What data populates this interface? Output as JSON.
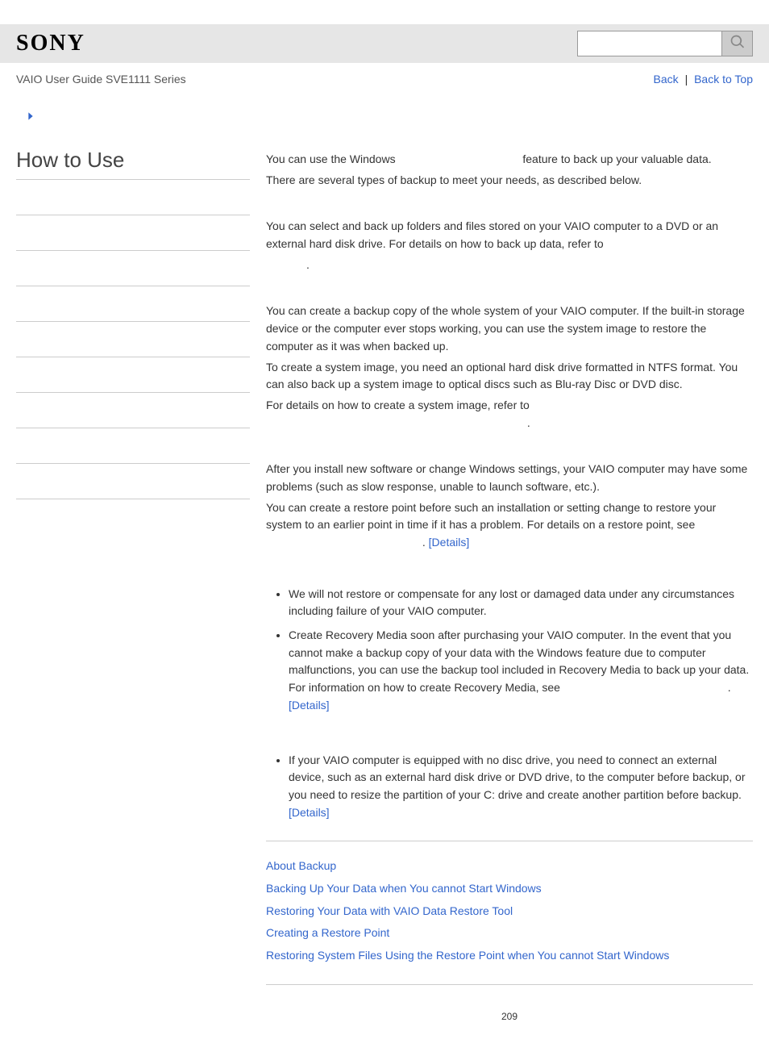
{
  "header": {
    "logo": "SONY",
    "search_placeholder": ""
  },
  "subbar": {
    "breadcrumb": "VAIO User Guide SVE1111 Series",
    "back": "Back",
    "back_to_top": "Back to Top"
  },
  "sidebar": {
    "title": "How to Use"
  },
  "content": {
    "intro1a": "You can use the Windows ",
    "intro1b": " feature to back up your valuable data.",
    "intro2": "There are several types of backup to meet your needs, as described below.",
    "sec1_p1": "You can select and back up folders and files stored on your VAIO computer to a DVD or an external hard disk drive. For details on how to back up data, refer to ",
    "sec1_p2": ".",
    "sec2_p1": "You can create a backup copy of the whole system of your VAIO computer. If the built-in storage device or the computer ever stops working, you can use the system image to restore the computer as it was when backed up.",
    "sec2_p2": "To create a system image, you need an optional hard disk drive formatted in NTFS format. You can also back up a system image to optical discs such as Blu-ray Disc or DVD disc.",
    "sec2_p3a": "For details on how to create a system image, refer to ",
    "sec2_p3b": ".",
    "sec3_p1": "After you install new software or change Windows settings, your VAIO computer may have some problems (such as slow response, unable to launch software, etc.).",
    "sec3_p2a": "You can create a restore point before such an installation or setting change to restore your system to an earlier point in time if it has a problem. For details on a restore point, see ",
    "sec3_p2b": ". ",
    "details": "[Details]",
    "note1_li1": "We will not restore or compensate for any lost or damaged data under any circumstances including failure of your VAIO computer.",
    "note1_li2a": "Create Recovery Media soon after purchasing your VAIO computer. In the event that you cannot make a backup copy of your data with the Windows feature due to computer malfunctions, you can use the backup tool included in Recovery Media to back up your data.",
    "note1_li2b": "For information on how to create Recovery Media, see ",
    "note1_li2c": ".",
    "note2_li1a": "If your VAIO computer is equipped with no disc drive, you need to connect an external device, such as an external hard disk drive or DVD drive, to the computer before backup, or you need to resize the partition of your C: drive and create another partition before backup. ",
    "related": [
      "About Backup",
      "Backing Up Your Data when You cannot Start Windows",
      "Restoring Your Data with VAIO Data Restore Tool",
      "Creating a Restore Point",
      "Restoring System Files Using the Restore Point when You cannot Start Windows"
    ],
    "page_number": "209"
  }
}
